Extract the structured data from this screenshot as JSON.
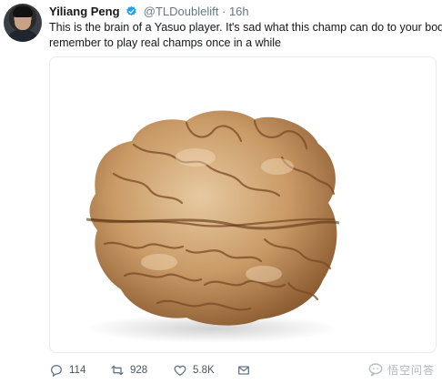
{
  "tweet": {
    "author_name": "Yiliang Peng",
    "handle": "@TLDoublelift",
    "separator": "·",
    "time": "16h",
    "text_line1": "This is the brain of a Yasuo player. It's sad what this champ can do to your body,",
    "text_line2": "remember to play real champs once in a while",
    "media_subject": "walnut-image",
    "actions": {
      "reply_count": "114",
      "retweet_count": "928",
      "like_count": "5.8K"
    },
    "icons": {
      "verified": "verified-badge-icon",
      "reply": "reply-icon",
      "retweet": "retweet-icon",
      "like": "heart-icon",
      "dm": "mail-icon"
    },
    "colors": {
      "verified": "#1da1f2",
      "icon_gray": "#657786"
    }
  },
  "watermark": {
    "text": "悟空问答"
  }
}
